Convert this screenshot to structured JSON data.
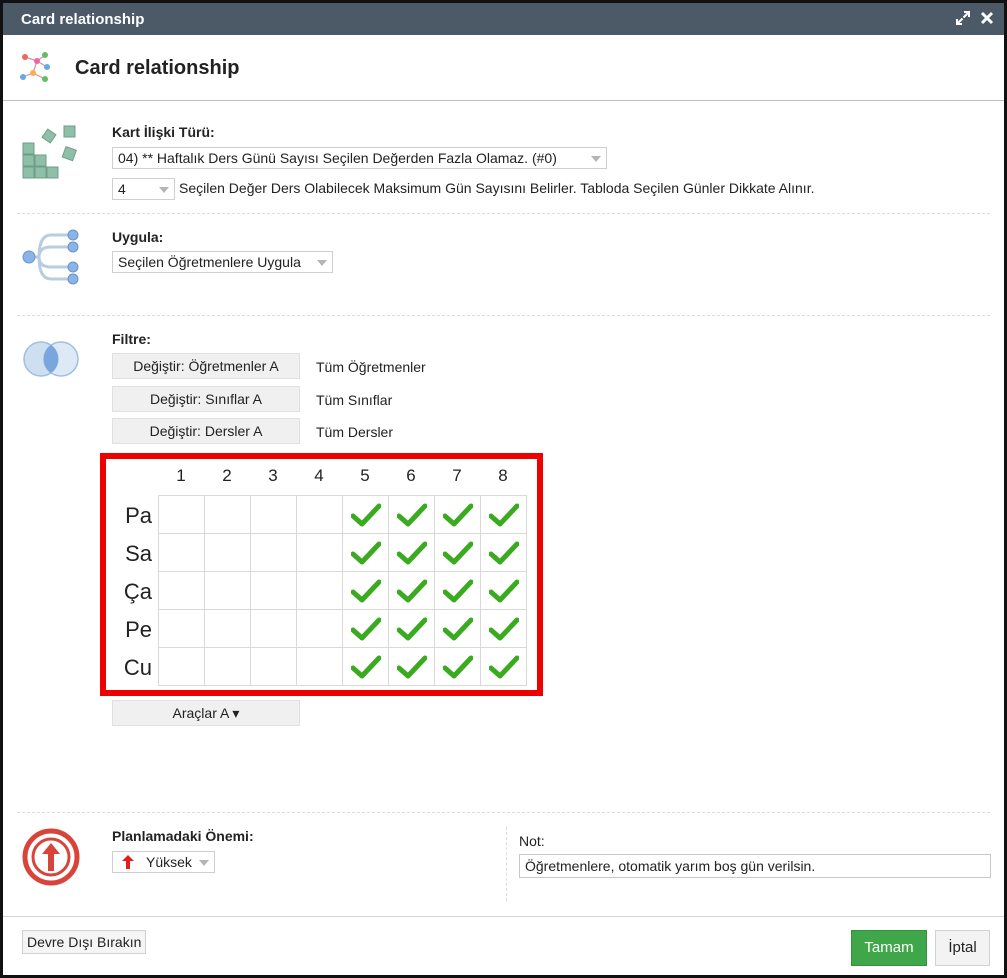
{
  "window": {
    "title": "Card relationship",
    "header_title": "Card relationship"
  },
  "relation_type": {
    "label": "Kart İlişki Türü:",
    "selected": "04) ** Haftalık Ders Günü Sayısı Seçilen Değerden Fazla Olamaz. (#0)",
    "value": "4",
    "description": "Seçilen Değer Ders Olabilecek Maksimum Gün Sayısını Belirler. Tabloda Seçilen Günler Dikkate Alınır."
  },
  "apply": {
    "label": "Uygula:",
    "selected": "Seçilen Öğretmenlere Uygula"
  },
  "filter": {
    "label": "Filtre:",
    "items": [
      {
        "button": "Değiştir: Öğretmenler A",
        "value": "Tüm Öğretmenler"
      },
      {
        "button": "Değiştir: Sınıflar A",
        "value": "Tüm Sınıflar"
      },
      {
        "button": "Değiştir: Dersler A",
        "value": "Tüm Dersler"
      }
    ]
  },
  "grid": {
    "columns": [
      "1",
      "2",
      "3",
      "4",
      "5",
      "6",
      "7",
      "8"
    ],
    "rows": [
      {
        "day": "Pa",
        "checked": [
          false,
          false,
          false,
          false,
          true,
          true,
          true,
          true
        ]
      },
      {
        "day": "Sa",
        "checked": [
          false,
          false,
          false,
          false,
          true,
          true,
          true,
          true
        ]
      },
      {
        "day": "Ça",
        "checked": [
          false,
          false,
          false,
          false,
          true,
          true,
          true,
          true
        ]
      },
      {
        "day": "Pe",
        "checked": [
          false,
          false,
          false,
          false,
          true,
          true,
          true,
          true
        ]
      },
      {
        "day": "Cu",
        "checked": [
          false,
          false,
          false,
          false,
          true,
          true,
          true,
          true
        ]
      }
    ],
    "highlight_color": "#ee0000",
    "check_color": "#3aaa1f"
  },
  "tools_button": "Araçlar A ▾",
  "importance": {
    "label": "Planlamadaki Önemi:",
    "selected": "Yüksek",
    "icon": "arrow-up-icon",
    "color": "#d9443a"
  },
  "note": {
    "label": "Not:",
    "value": "Öğretmenlere, otomatik yarım boş gün verilsin."
  },
  "footer": {
    "disable_label": "Devre Dışı Bırakın",
    "ok_label": "Tamam",
    "cancel_label": "İptal",
    "ok_color": "#3fa74a"
  },
  "colors": {
    "titlebar": "#4c5a68",
    "icon_green": "#8fbfa8",
    "icon_blue": "#a7c7e7"
  }
}
